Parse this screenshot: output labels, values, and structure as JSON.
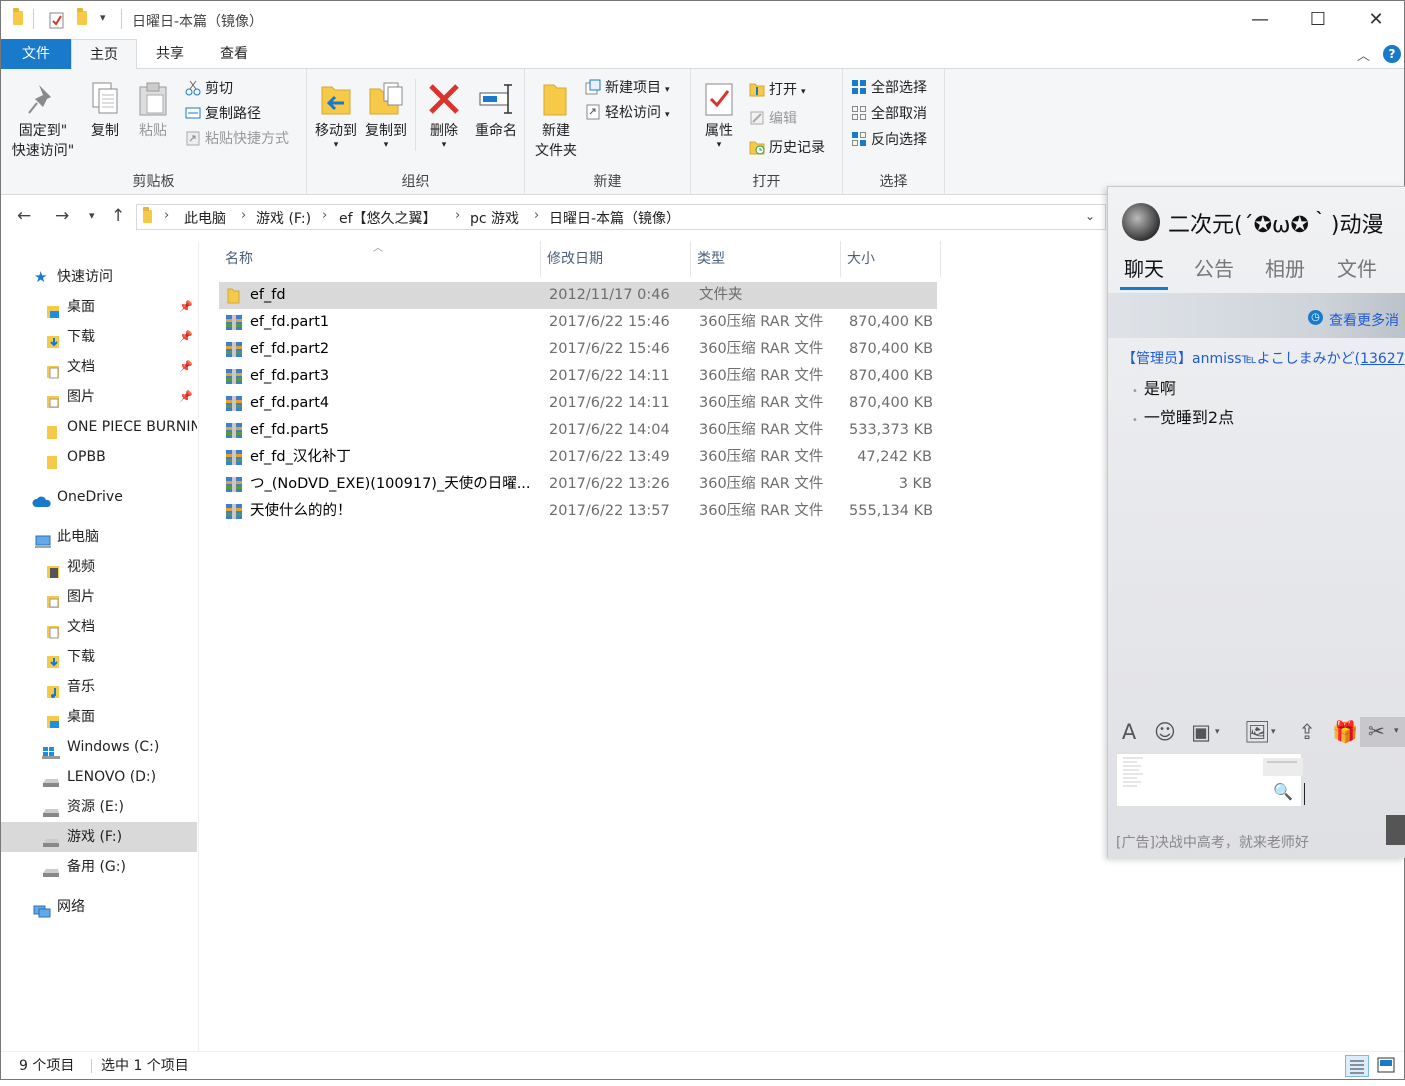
{
  "window": {
    "title": "日曜日-本篇（镜像）",
    "minimize": "—",
    "maximize": "☐",
    "close": "✕"
  },
  "ribbon_tabs": [
    "文件",
    "主页",
    "共享",
    "查看"
  ],
  "ribbon": {
    "clipboard": {
      "label": "剪贴板",
      "pin_line1": "固定到\"",
      "pin_line2": "快速访问\"",
      "copy": "复制",
      "paste": "粘贴",
      "cut": "剪切",
      "copy_path": "复制路径",
      "paste_shortcut": "粘贴快捷方式"
    },
    "organize": {
      "label": "组织",
      "move_to": "移动到",
      "copy_to": "复制到",
      "delete": "删除",
      "rename": "重命名"
    },
    "new": {
      "label": "新建",
      "new_folder_line1": "新建",
      "new_folder_line2": "文件夹",
      "new_item": "新建项目",
      "easy_access": "轻松访问"
    },
    "open": {
      "label": "打开",
      "properties": "属性",
      "open": "打开",
      "edit": "编辑",
      "history": "历史记录"
    },
    "select": {
      "label": "选择",
      "select_all": "全部选择",
      "select_none": "全部取消",
      "invert": "反向选择"
    }
  },
  "address": {
    "crumbs": [
      "此电脑",
      "游戏 (F:)",
      "ef【悠久之翼】",
      "pc 游戏",
      "日曜日-本篇（镜像）"
    ]
  },
  "nav": {
    "quick_access": "快速访问",
    "qa_items": [
      "桌面",
      "下载",
      "文档",
      "图片"
    ],
    "folders": [
      "ONE PIECE BURNIN",
      "OPBB"
    ],
    "onedrive": "OneDrive",
    "this_pc": "此电脑",
    "pc_items": [
      "视频",
      "图片",
      "文档",
      "下载",
      "音乐",
      "桌面"
    ],
    "drives": [
      "Windows (C:)",
      "LENOVO (D:)",
      "资源 (E:)",
      "游戏 (F:)",
      "备用 (G:)"
    ],
    "network": "网络"
  },
  "columns": [
    "名称",
    "修改日期",
    "类型",
    "大小"
  ],
  "files": [
    {
      "name": "ef_fd",
      "date": "2012/11/17 0:46",
      "type": "文件夹",
      "size": ""
    },
    {
      "name": "ef_fd.part1",
      "date": "2017/6/22 15:46",
      "type": "360压缩 RAR 文件",
      "size": "870,400 KB"
    },
    {
      "name": "ef_fd.part2",
      "date": "2017/6/22 15:46",
      "type": "360压缩 RAR 文件",
      "size": "870,400 KB"
    },
    {
      "name": "ef_fd.part3",
      "date": "2017/6/22 14:11",
      "type": "360压缩 RAR 文件",
      "size": "870,400 KB"
    },
    {
      "name": "ef_fd.part4",
      "date": "2017/6/22 14:11",
      "type": "360压缩 RAR 文件",
      "size": "870,400 KB"
    },
    {
      "name": "ef_fd.part5",
      "date": "2017/6/22 14:04",
      "type": "360压缩 RAR 文件",
      "size": "533,373 KB"
    },
    {
      "name": "ef_fd_汉化补丁",
      "date": "2017/6/22 13:49",
      "type": "360压缩 RAR 文件",
      "size": "47,242 KB"
    },
    {
      "name": "つ_(NoDVD_EXE)(100917)_天使の日曜...",
      "date": "2017/6/22 13:26",
      "type": "360压缩 RAR 文件",
      "size": "3 KB"
    },
    {
      "name": "天使什么的的！",
      "date": "2017/6/22 13:57",
      "type": "360压缩 RAR 文件",
      "size": "555,134 KB"
    }
  ],
  "status": {
    "count": "9 个项目",
    "selected": "选中 1 个项目"
  },
  "chat": {
    "group_name": "二次元(´✪ω✪｀)动漫",
    "tabs": [
      "聊天",
      "公告",
      "相册",
      "文件"
    ],
    "more_link": "查看更多消",
    "sender_role": "【管理员】",
    "sender_name": "anmiss℡よこしまみかど",
    "sender_id": "(13627",
    "messages": [
      "是啊",
      "一觉睡到2点"
    ],
    "ad": "[广告]决战中高考，就来老师好"
  },
  "colors": {
    "accent": "#1979ca",
    "selected_row": "#d9d9d9",
    "nav_selected": "#cce8ff",
    "chat_link": "#1d5ad6"
  }
}
